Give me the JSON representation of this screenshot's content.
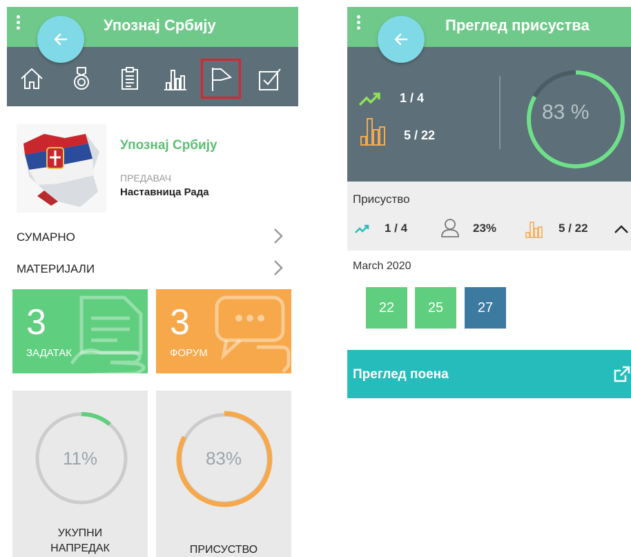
{
  "left": {
    "header": {
      "title": "Упознај Србију"
    },
    "nav_icons": [
      "home-icon",
      "medal-icon",
      "clipboard-icon",
      "bar-chart-icon",
      "flag-icon",
      "checkbox-icon"
    ],
    "selected_nav": "flag-icon",
    "course": {
      "title": "Упознај Србију",
      "lecturer_label": "ПРЕДАВАЧ",
      "lecturer_name": "Наставница Рада"
    },
    "menu": [
      {
        "label": "СУМАРНО"
      },
      {
        "label": "МАТЕРИЈАЛИ"
      }
    ],
    "tiles": {
      "tasks": {
        "count": "3",
        "label": "ЗАДАТАК",
        "color": "#5fce7e"
      },
      "forum": {
        "count": "3",
        "label": "ФОРУМ",
        "color": "#f7a84a"
      }
    },
    "stats": {
      "progress": {
        "value": "11%",
        "fraction": 0.11,
        "label_line1": "УКУПНИ",
        "label_line2": "НАПРЕДАК",
        "color": "#5fce7e"
      },
      "attendance": {
        "value": "83%",
        "fraction": 0.83,
        "label": "ПРИСУСТВО",
        "color": "#f7a84a"
      }
    }
  },
  "right": {
    "header": {
      "title": "Преглед присуства"
    },
    "summary": {
      "trend": "1 / 4",
      "sessions": "5 / 22",
      "percent": "83 %",
      "fraction": 0.83
    },
    "attendance": {
      "heading": "Присуство",
      "trend": "1 / 4",
      "share": "23%",
      "sessions": "5 / 22"
    },
    "month": "March 2020",
    "days": [
      {
        "day": "22",
        "color": "#5fce7e"
      },
      {
        "day": "25",
        "color": "#5fce7e"
      },
      {
        "day": "27",
        "color": "#3d7aa0"
      }
    ],
    "points": {
      "title": "Преглед поена"
    }
  },
  "colors": {
    "green": "#6fc98a",
    "slate": "#5d6f78",
    "teal": "#27bcbc",
    "orange": "#f7a84a",
    "highlight": "#d8262d"
  }
}
